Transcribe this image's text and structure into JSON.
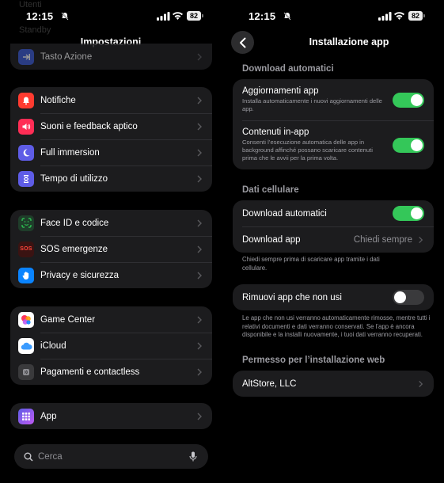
{
  "status": {
    "time": "12:15",
    "battery": "82"
  },
  "left": {
    "ghost_items": [
      "Utenti",
      "Standby"
    ],
    "title": "Impostazioni",
    "groups": [
      [
        {
          "label": "Tasto Azione",
          "icon": "action-button-icon",
          "color": "#3b5bdb"
        }
      ],
      [
        {
          "label": "Notifiche",
          "icon": "bell-icon",
          "color": "#ff3b30"
        },
        {
          "label": "Suoni e feedback aptico",
          "icon": "speaker-icon",
          "color": "#ff2d55"
        },
        {
          "label": "Full immersion",
          "icon": "moon-icon",
          "color": "#5e5ce6"
        },
        {
          "label": "Tempo di utilizzo",
          "icon": "hourglass-icon",
          "color": "#5e5ce6"
        }
      ],
      [
        {
          "label": "Face ID e codice",
          "icon": "face-id-icon",
          "color": "#30d158"
        },
        {
          "label": "SOS emergenze",
          "icon": "sos-icon",
          "color": "#ff3b30"
        },
        {
          "label": "Privacy e sicurezza",
          "icon": "hand-icon",
          "color": "#0a84ff"
        }
      ],
      [
        {
          "label": "Game Center",
          "icon": "game-center-icon",
          "color": "#ff9f0a"
        },
        {
          "label": "iCloud",
          "icon": "cloud-icon",
          "color": "#0a84ff"
        },
        {
          "label": "Pagamenti e contactless",
          "icon": "wallet-icon",
          "color": "#636366"
        }
      ],
      [
        {
          "label": "App",
          "icon": "app-grid-icon",
          "color": "#5e5ce6"
        }
      ]
    ],
    "search_placeholder": "Cerca"
  },
  "right": {
    "title": "Installazione app",
    "sections": {
      "auto_download": "Download automatici",
      "cellular": "Dati cellulare",
      "web_install": "Permesso per l’installazione web"
    },
    "auto_download_rows": [
      {
        "title": "Aggiornamenti app",
        "desc": "Installa automaticamente i nuovi aggiornamenti delle app.",
        "on": true
      },
      {
        "title": "Contenuti in-app",
        "desc": "Consenti l’esecuzione automatica delle app in background affinché possano scaricare contenuti prima che le avvii per la prima volta.",
        "on": true
      }
    ],
    "cellular_rows": {
      "auto_label": "Download automatici",
      "auto_on": true,
      "app_label": "Download app",
      "app_value": "Chiedi sempre"
    },
    "cellular_footer": "Chiedi sempre prima di scaricare app tramite i dati cellulare.",
    "offload": {
      "label": "Rimuovi app che non usi",
      "on": false
    },
    "offload_footer": "Le app che non usi verranno automaticamente rimosse, mentre tutti i relativi documenti e dati verranno conservati. Se l’app è ancora disponibile e la installi nuovamente, i tuoi dati verranno recuperati.",
    "web_item": "AltStore, LLC"
  }
}
